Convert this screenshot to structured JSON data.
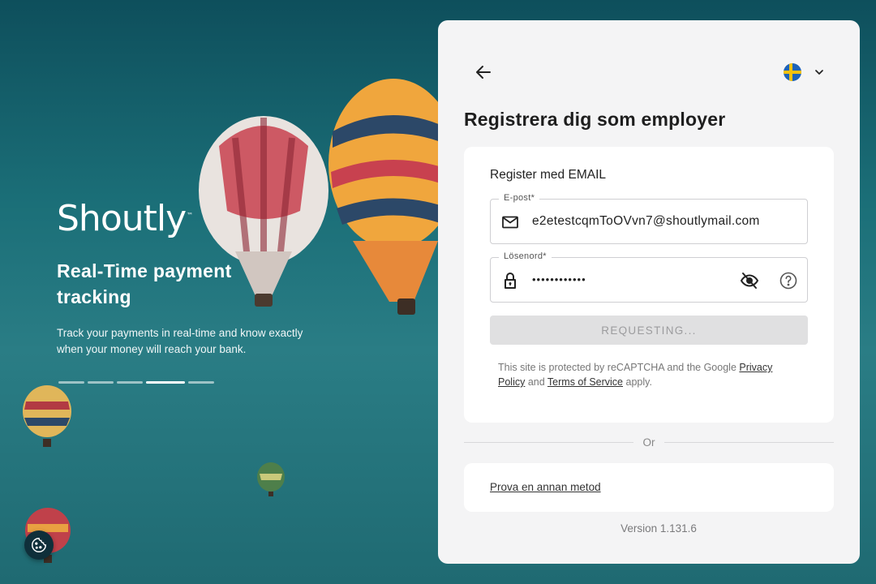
{
  "hero": {
    "brand": "Shoutly",
    "brand_mark": "™",
    "title": "Real-Time payment tracking",
    "description": "Track your payments in real-time and know exactly when your money will reach your bank.",
    "slides_total": 5,
    "slide_active": 4
  },
  "panel": {
    "language": "Svenska",
    "title": "Registrera dig som employer",
    "form": {
      "heading": "Register med EMAIL",
      "email_label": "E-post*",
      "email_value": "e2etestcqmToOVvn7@shoutlymail.com",
      "password_label": "Lösenord*",
      "password_value": "••••••••••••",
      "submit_label": "REQUESTING..."
    },
    "recaptcha": {
      "prefix": "This site is protected by reCAPTCHA and the Google ",
      "privacy_link": "Privacy Policy",
      "middle": " and ",
      "terms_link": "Terms of Service",
      "suffix": " apply."
    },
    "divider": "Or",
    "alt_method": "Prova en annan metod",
    "version": "Version 1.131.6"
  },
  "colors": {
    "background": "#1b6f78",
    "panel": "#f4f4f5",
    "card": "#ffffff",
    "button_disabled": "#e0e0e1",
    "flag_blue": "#1e63b8",
    "flag_yellow": "#f4c20d"
  },
  "icons": [
    "arrow-left-icon",
    "sweden-flag-icon",
    "chevron-down-icon",
    "mail-icon",
    "lock-icon",
    "eye-off-icon",
    "help-icon",
    "cookie-icon"
  ]
}
